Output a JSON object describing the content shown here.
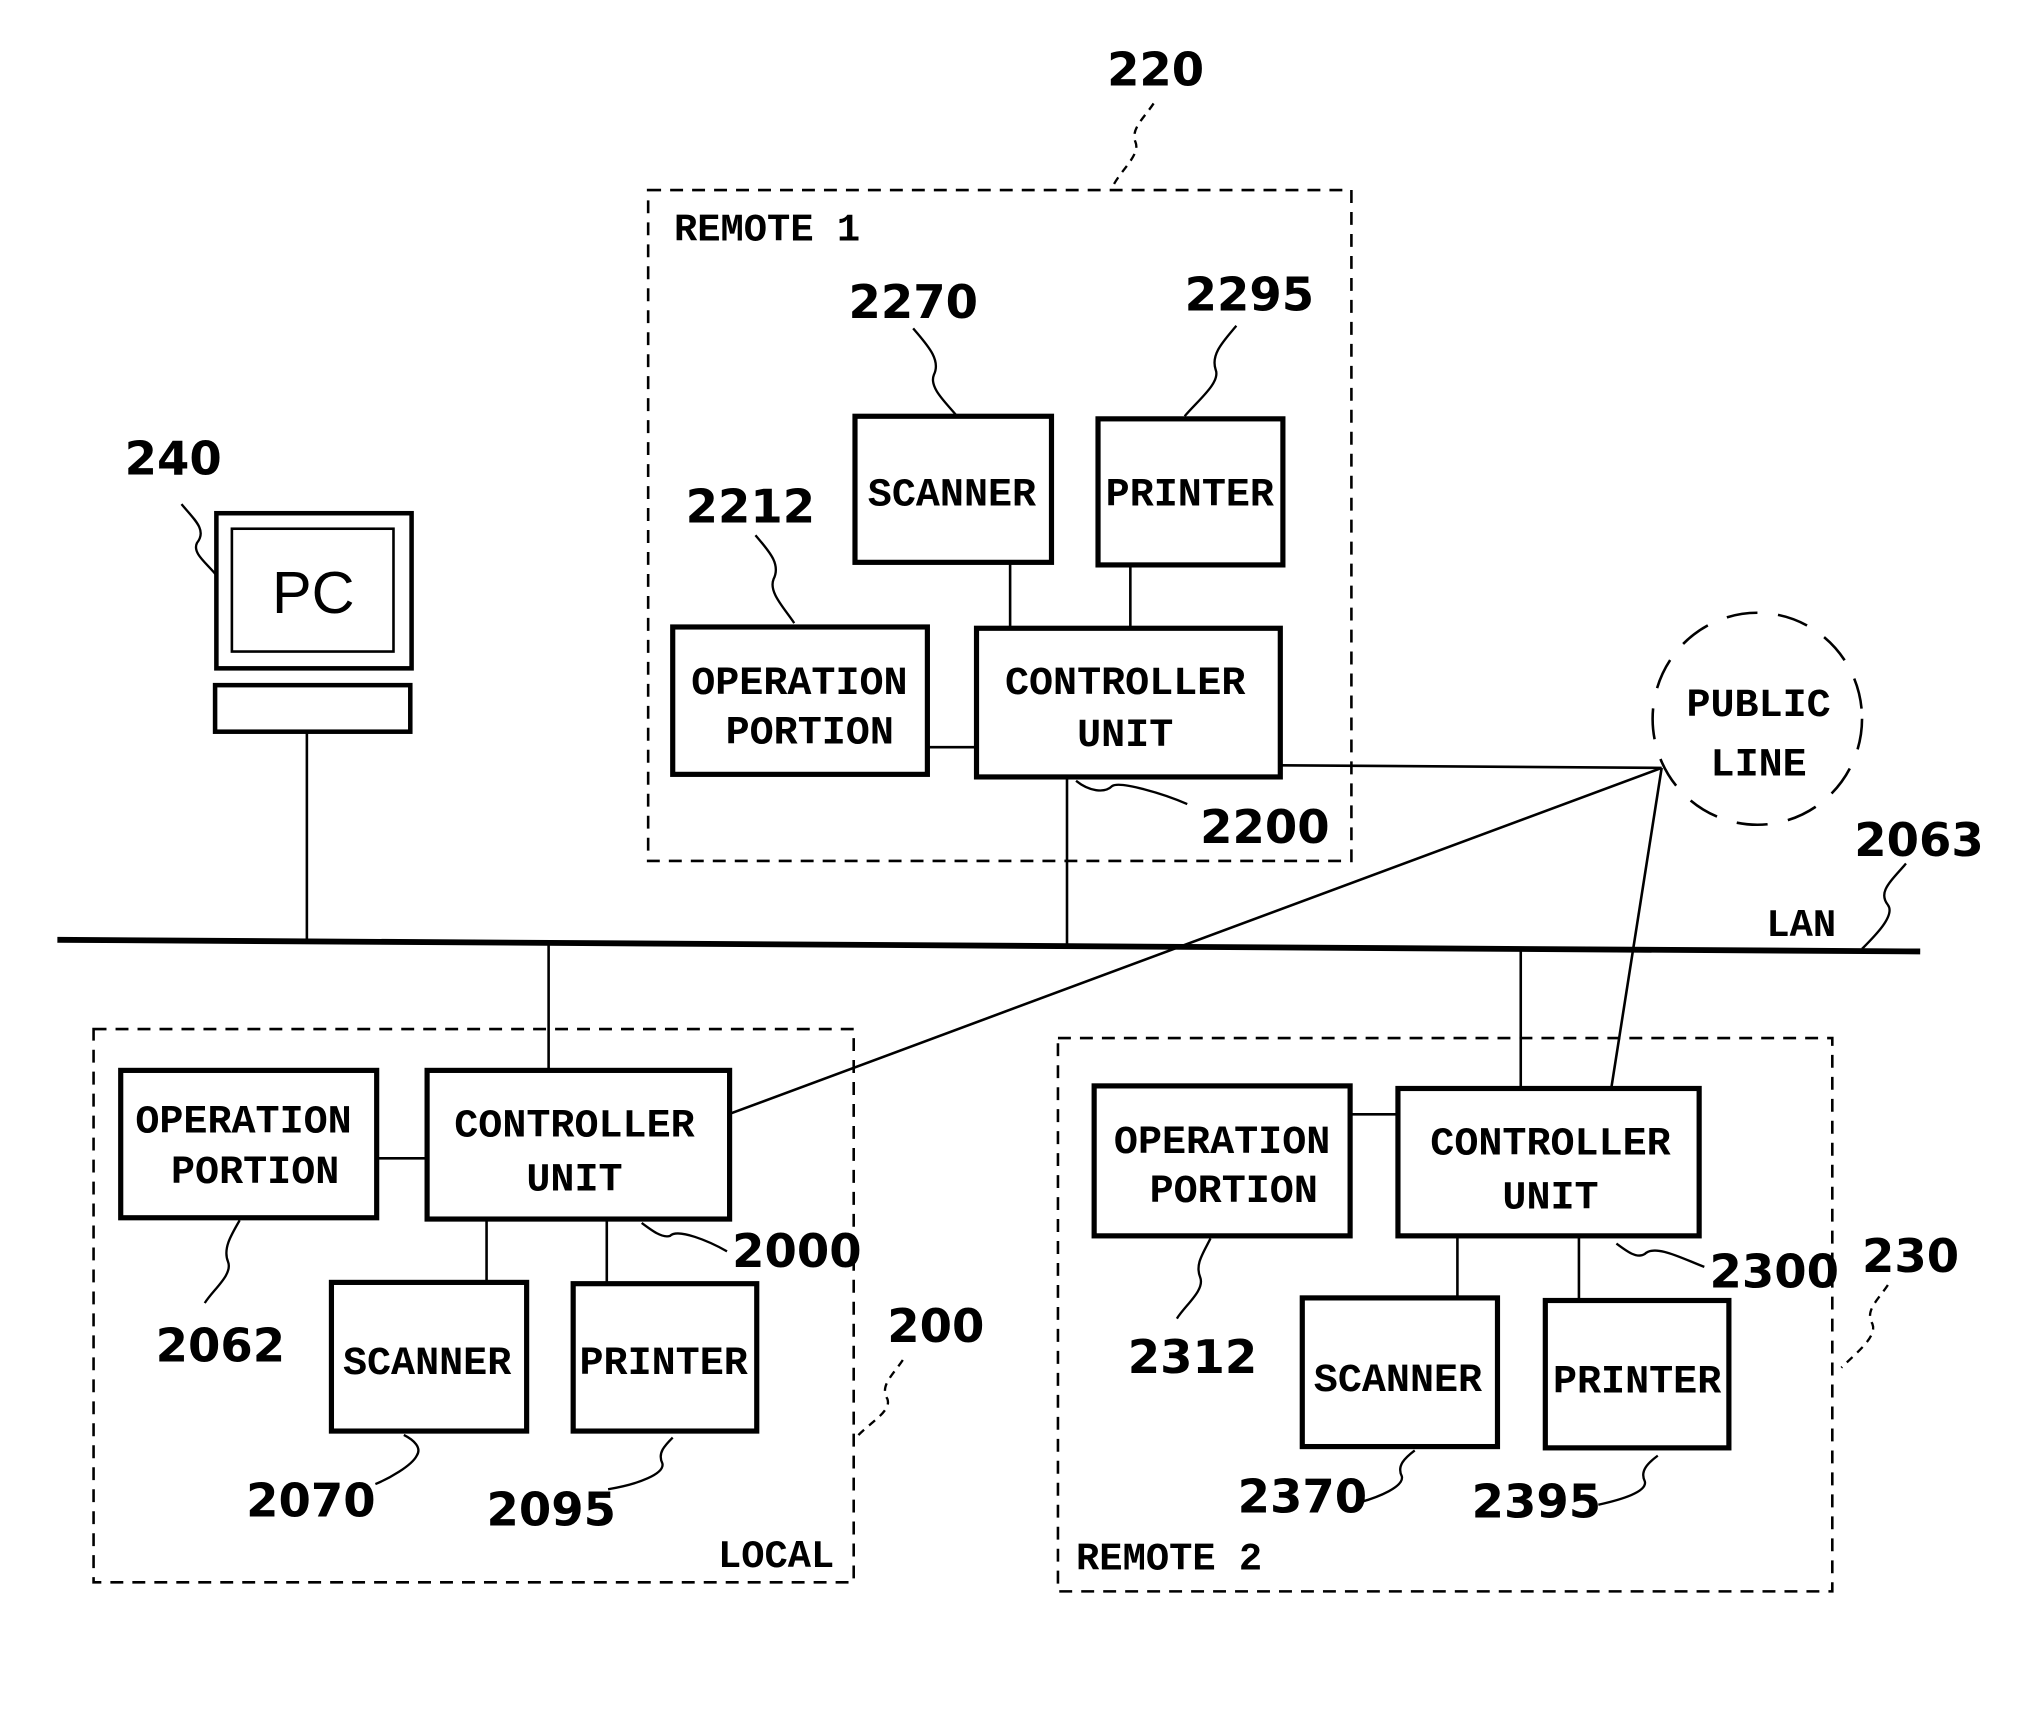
{
  "figure": {
    "remote1": {
      "ref": "220",
      "title": "REMOTE 1",
      "scanner": {
        "label": "SCANNER",
        "ref": "2270"
      },
      "printer": {
        "label": "PRINTER",
        "ref": "2295"
      },
      "operation": {
        "line1": "OPERATION",
        "line2": "PORTION",
        "ref": "2212"
      },
      "controller": {
        "line1": "CONTROLLER",
        "line2": "UNIT",
        "ref": "2200"
      }
    },
    "local": {
      "ref": "200",
      "title": "LOCAL",
      "operation": {
        "line1": "OPERATION",
        "line2": "PORTION",
        "ref": "2062"
      },
      "controller": {
        "line1": "CONTROLLER",
        "line2": "UNIT",
        "ref": "2000"
      },
      "scanner": {
        "label": "SCANNER",
        "ref": "2070"
      },
      "printer": {
        "label": "PRINTER",
        "ref": "2095"
      }
    },
    "remote2": {
      "ref": "230",
      "title": "REMOTE 2",
      "operation": {
        "line1": "OPERATION",
        "line2": "PORTION",
        "ref": "2312"
      },
      "controller": {
        "line1": "CONTROLLER",
        "line2": "UNIT",
        "ref": "2300"
      },
      "scanner": {
        "label": "SCANNER",
        "ref": "2370"
      },
      "printer": {
        "label": "PRINTER",
        "ref": "2395"
      }
    },
    "pc": {
      "label": "PC",
      "ref": "240"
    },
    "public_line": {
      "line1": "PUBLIC",
      "line2": "LINE"
    },
    "lan": {
      "label": "LAN",
      "ref": "2063"
    }
  }
}
